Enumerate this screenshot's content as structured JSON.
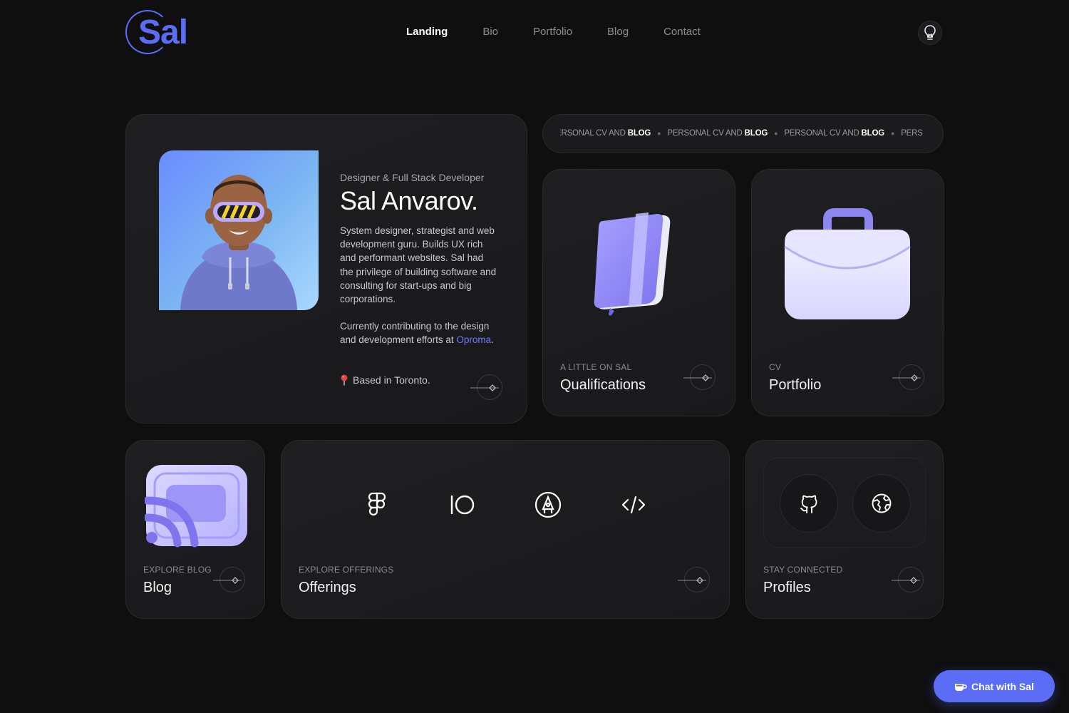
{
  "header": {
    "logo_text": "Sal",
    "nav": [
      {
        "label": "Landing",
        "active": true
      },
      {
        "label": "Bio",
        "active": false
      },
      {
        "label": "Portfolio",
        "active": false
      },
      {
        "label": "Blog",
        "active": false
      },
      {
        "label": "Contact",
        "active": false
      }
    ],
    "theme_icon": "lightbulb-icon"
  },
  "bio": {
    "role": "Designer & Full Stack Developer",
    "name": "Sal Anvarov.",
    "description": "System designer, strategist and web development guru. Builds UX rich and performant websites. Sal had the privilege of building software and consulting for start-ups and big corporations.",
    "contributing_prefix": "Currently contributing to the design and development efforts at ",
    "contributing_link": "Oproma",
    "contributing_suffix": ".",
    "location": "Based in Toronto.",
    "location_icon": "pin-icon"
  },
  "marquee": {
    "items": [
      {
        "text": "ERSONAL CV AND ",
        "bold": "BLOG"
      },
      {
        "text": "PERSONAL CV AND ",
        "bold": "BLOG"
      },
      {
        "text": "PERSONAL CV AND ",
        "bold": "BLOG"
      },
      {
        "text": "PERS",
        "bold": ""
      }
    ]
  },
  "cards": {
    "qualifications": {
      "label": "A LITTLE ON SAL",
      "title": "Qualifications",
      "icon": "book-icon"
    },
    "portfolio": {
      "label": "CV",
      "title": "Portfolio",
      "icon": "briefcase-icon"
    },
    "blog": {
      "label": "EXPLORE BLOG",
      "title": "Blog",
      "icon": "feed-icon"
    },
    "offerings": {
      "label": "EXPLORE OFFERINGS",
      "title": "Offerings",
      "icons": [
        "figma-icon",
        "io-icon",
        "pen-tool-icon",
        "code-icon"
      ]
    },
    "profiles": {
      "label": "STAY CONNECTED",
      "title": "Profiles",
      "icons": [
        "github-icon",
        "globe-icon"
      ]
    }
  },
  "chat": {
    "label": "Chat with Sal",
    "icon": "coffee-icon"
  },
  "colors": {
    "accent": "#5b6cf7",
    "background": "#0f0f10",
    "card": "#1d1d1f",
    "purple_3d": "#8f88f5"
  }
}
